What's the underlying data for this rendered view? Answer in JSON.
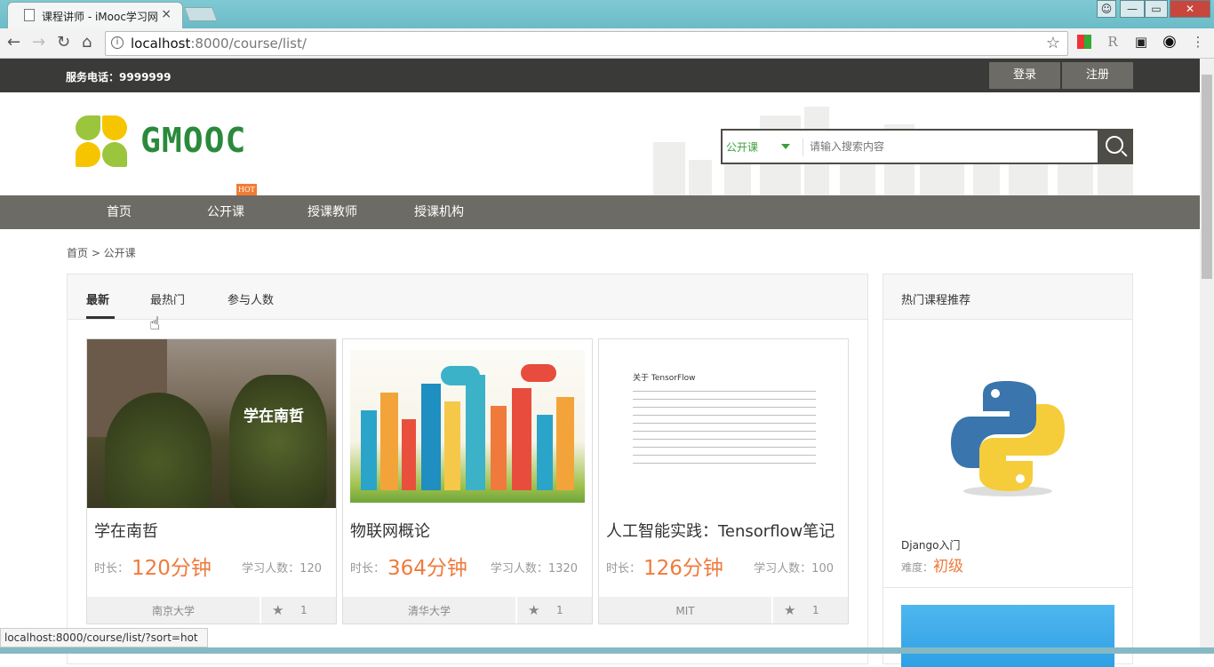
{
  "browser": {
    "tab_title": "课程讲师 - iMooc学习网",
    "tab_close": "×",
    "url_host": "localhost",
    "url_path": ":8000/course/list/",
    "window_minimize": "—",
    "window_maximize": "▭",
    "window_close": "✕",
    "extensions": [
      "R"
    ]
  },
  "topbar": {
    "phone_label": "服务电话：",
    "phone_number": "9999999",
    "login": "登录",
    "register": "注册"
  },
  "header": {
    "logo_text": "GMOOC",
    "search_scope": "公开课",
    "search_placeholder": "请输入搜索内容"
  },
  "nav": {
    "items": [
      "首页",
      "公开课",
      "授课教师",
      "授课机构"
    ],
    "hot_badge": "HOT"
  },
  "breadcrumb": "首页 > 公开课",
  "sort_tabs": {
    "items": [
      "最新",
      "最热门",
      "参与人数"
    ],
    "active": "最新"
  },
  "courses": [
    {
      "name": "学在南哲",
      "duration_label": "时长：",
      "duration": "120分钟",
      "students": "学习人数：120",
      "org": "南京大学",
      "favs": "1",
      "image_caption": "学在南哲"
    },
    {
      "name": "物联网概论",
      "duration_label": "时长：",
      "duration": "364分钟",
      "students": "学习人数：1320",
      "org": "清华大学",
      "favs": "1"
    },
    {
      "name": "人工智能实践：Tensorflow笔记",
      "duration_label": "时长：",
      "duration": "126分钟",
      "students": "学习人数：100",
      "org": "MIT",
      "favs": "1",
      "image_title": "关于 TensorFlow"
    }
  ],
  "sidebar": {
    "title": "热门课程推荐",
    "course_name": "Django入门",
    "level_label": "难度：",
    "level": "初级"
  },
  "status_bar": "localhost:8000/course/list/?sort=hot",
  "colors": {
    "accent": "#f07a3c",
    "nav_bg": "#6d6b65",
    "topbar_bg": "#3a3a38",
    "logo_green": "#2a8a3b"
  }
}
